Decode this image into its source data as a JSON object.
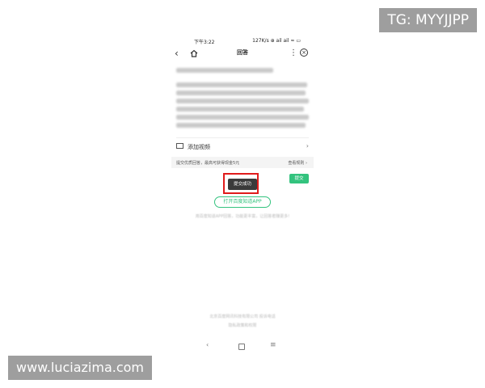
{
  "status_bar": {
    "time": "下午3:22",
    "right": "127K/s ⊕ ail ail ≈ ▭"
  },
  "nav": {
    "back_icon": "chevron-left-icon",
    "home_icon": "home-icon",
    "title": "回答",
    "more_icon": "more-vert-icon",
    "close_icon": "close-circle-icon"
  },
  "add_video": {
    "icon": "video-icon",
    "label": "添加视频",
    "chevron": "›"
  },
  "tip_bar": {
    "left_text": "提交优质回答，最高可获得现金5元",
    "right_text": "查看规则 ›"
  },
  "submit_button": "提交",
  "toast": "提交成功",
  "open_app_button": "打开百度知道APP",
  "hint_text": "用百度知道APP回答，功能更丰富，让回答者赚更多!",
  "footer": {
    "line1": "北京百度网讯科技有限公司 投诉电话",
    "line2": "隐私政策和权限"
  },
  "system_nav": {
    "back": "‹",
    "menu": "≡"
  },
  "watermarks": {
    "top_right": "TG: MYYJJPP",
    "bottom_left": "www.luciazima.com"
  },
  "colors": {
    "accent_green": "#33c37e",
    "highlight_red": "#e01b1b",
    "toast_bg": "#3a3a3a",
    "watermark_bg": "#9e9e9e"
  }
}
